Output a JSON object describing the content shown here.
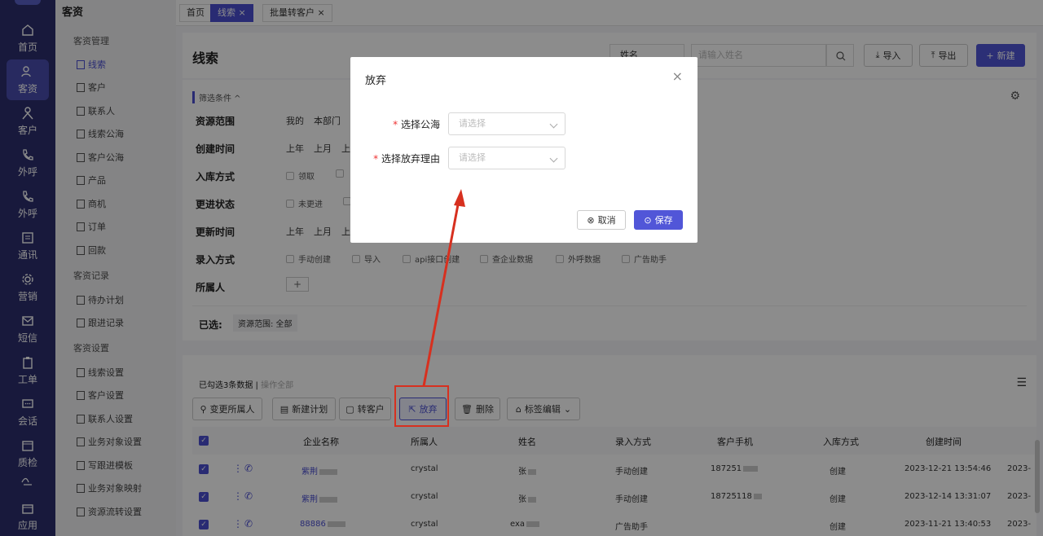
{
  "rail": {
    "items": [
      {
        "label": "首页",
        "icon": "home-icon"
      },
      {
        "label": "客资",
        "icon": "users-icon"
      },
      {
        "label": "客户",
        "icon": "person-icon"
      },
      {
        "label": "外呼",
        "icon": "phone-out-icon"
      },
      {
        "label": "外呼",
        "icon": "phone-icon"
      },
      {
        "label": "通讯",
        "icon": "grid-icon"
      },
      {
        "label": "营销",
        "icon": "gear-icon"
      },
      {
        "label": "短信",
        "icon": "mail-icon"
      },
      {
        "label": "工单",
        "icon": "clipboard-icon"
      },
      {
        "label": "会话",
        "icon": "chat-icon"
      },
      {
        "label": "质检",
        "icon": "calendar-icon"
      },
      {
        "label": "",
        "icon": "wave-icon"
      },
      {
        "label": "应用",
        "icon": "box-icon"
      }
    ]
  },
  "submenu": {
    "title": "客资",
    "groups": [
      "客资管理",
      "客资记录",
      "客资设置"
    ],
    "items": [
      "线索",
      "客户",
      "联系人",
      "线索公海",
      "客户公海",
      "产品",
      "商机",
      "订单",
      "回款",
      "待办计划",
      "跟进记录",
      "线索设置",
      "客户设置",
      "联系人设置",
      "业务对象设置",
      "写跟进模板",
      "业务对象映射",
      "资源流转设置"
    ]
  },
  "tabs": [
    "首页",
    "线索 ×",
    "批量转客户 ×"
  ],
  "header": {
    "title": "线索",
    "search_field": "姓名",
    "search_placeholder": "请输入姓名",
    "import": "导入",
    "export": "导出",
    "new": "新建"
  },
  "filter": {
    "title": "筛选条件 ^",
    "rows": [
      {
        "label": "资源范围",
        "options": [
          "我的",
          "本部门"
        ]
      },
      {
        "label": "创建时间",
        "options": [
          "上年",
          "上月",
          "上"
        ]
      },
      {
        "label": "入库方式",
        "checks": [
          "领取",
          "("
        ]
      },
      {
        "label": "更进状态",
        "checks": [
          "未更进",
          "("
        ]
      },
      {
        "label": "更新时间",
        "options": [
          "上年",
          "上月",
          "上"
        ]
      },
      {
        "label": "录入方式",
        "checks": [
          "手动创建",
          "导入",
          "api接口创建",
          "查企业数据",
          "外呼数据",
          "广告助手"
        ]
      },
      {
        "label": "所属人",
        "add": "+"
      }
    ],
    "selected_label": "已选:",
    "selected_tag": "资源范围: 全部"
  },
  "toolbar": {
    "selected_info": "已勾选3条数据",
    "op_all": "操作全部",
    "buttons": [
      "变更所属人",
      "新建计划",
      "转客户",
      "放弃",
      "删除",
      "标签编辑"
    ]
  },
  "table": {
    "headers": [
      "企业名称",
      "所属人",
      "姓名",
      "录入方式",
      "客户手机",
      "入库方式",
      "创建时间"
    ],
    "rows": [
      {
        "company": "紫荆",
        "owner": "crystal",
        "name": "张",
        "entry": "手动创建",
        "phone": "187251",
        "storage": "创建",
        "created": "2023-12-21 13:54:46",
        "extra": "2023-"
      },
      {
        "company": "紫荆",
        "owner": "crystal",
        "name": "张",
        "entry": "手动创建",
        "phone": "18725118",
        "storage": "创建",
        "created": "2023-12-14 13:31:07",
        "extra": "2023-"
      },
      {
        "company": "88886",
        "owner": "crystal",
        "name": "exa",
        "entry": "广告助手",
        "phone": "",
        "storage": "创建",
        "created": "2023-11-21 13:40:53",
        "extra": "2023-"
      }
    ]
  },
  "modal": {
    "title": "放弃",
    "field1_label": "选择公海",
    "field2_label": "选择放弃理由",
    "placeholder": "请选择",
    "cancel": "取消",
    "save": "保存",
    "required": "*"
  },
  "colors": {
    "accent": "#5156d8",
    "arrow": "#d7301f"
  }
}
